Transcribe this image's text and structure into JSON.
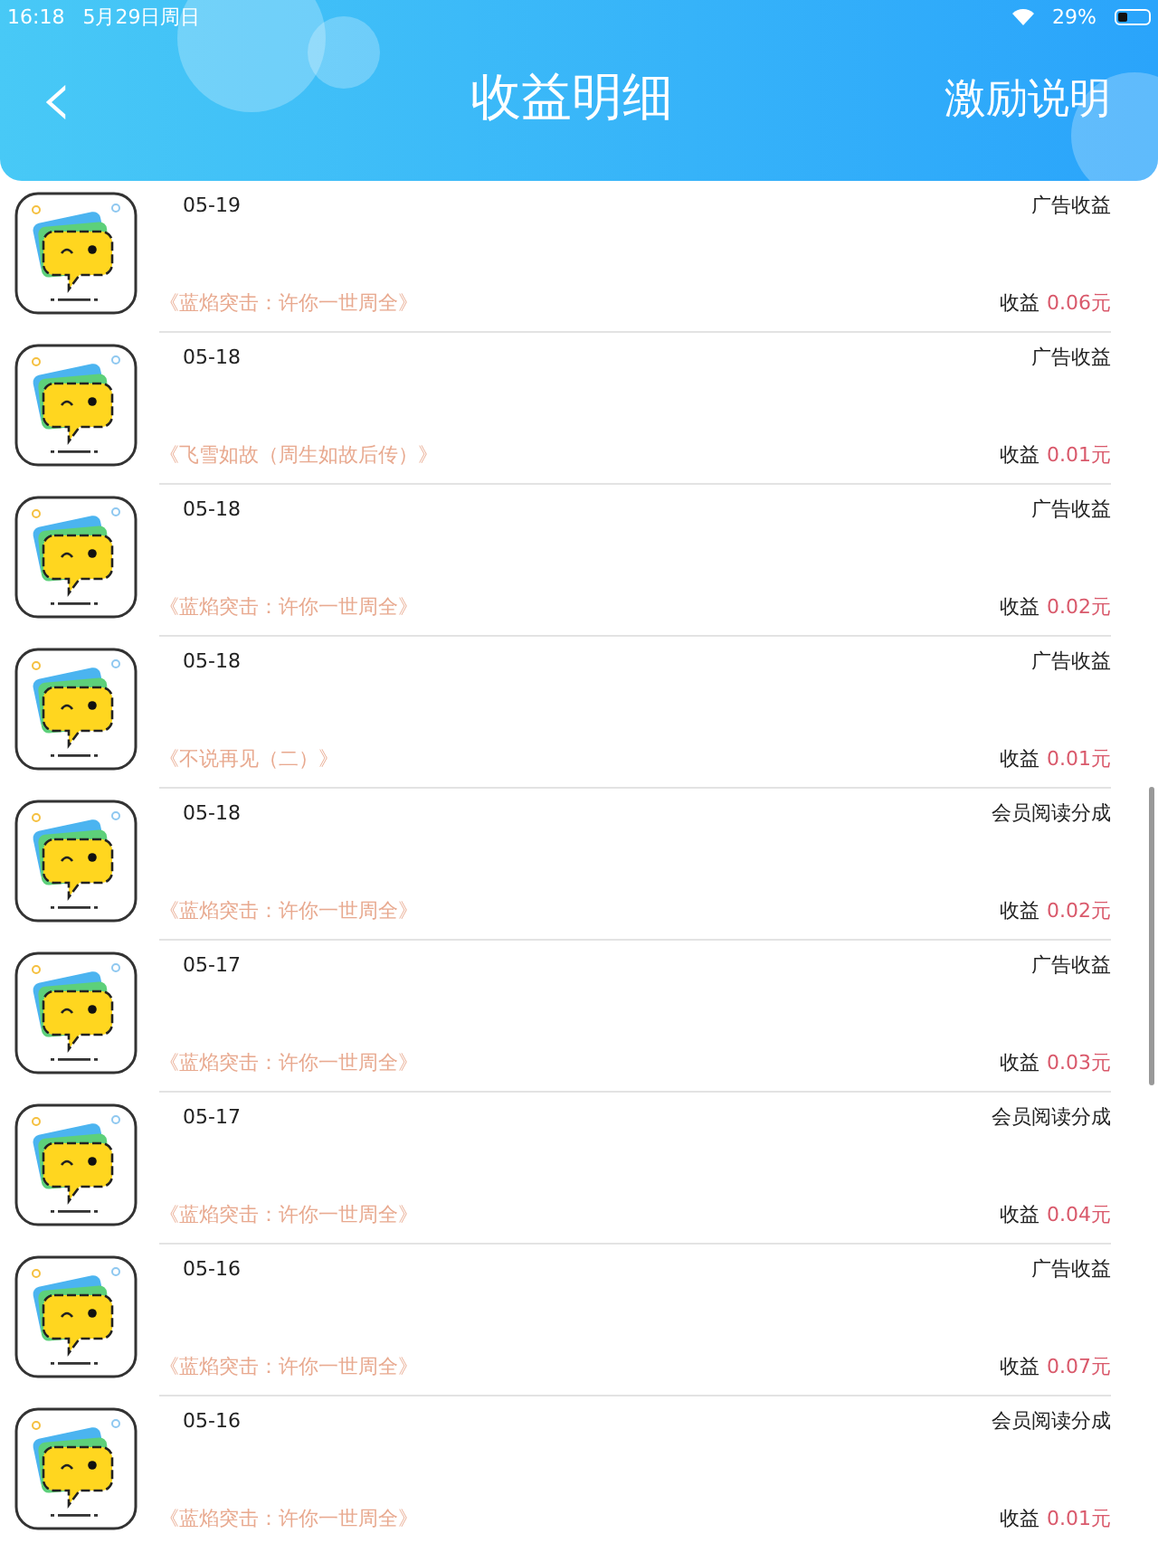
{
  "status_bar": {
    "time": "16:18",
    "date": "5月29日周日",
    "battery": "29%"
  },
  "header": {
    "back": "‹",
    "title": "收益明细",
    "action": "激励说明"
  },
  "rows": [
    {
      "date": "05-19",
      "type": "广告收益",
      "book": "《蓝焰突击：许你一世周全》",
      "earning_label": "收益",
      "amount": "0.06元"
    },
    {
      "date": "05-18",
      "type": "广告收益",
      "book": "《飞雪如故（周生如故后传）》",
      "earning_label": "收益",
      "amount": "0.01元"
    },
    {
      "date": "05-18",
      "type": "广告收益",
      "book": "《蓝焰突击：许你一世周全》",
      "earning_label": "收益",
      "amount": "0.02元"
    },
    {
      "date": "05-18",
      "type": "广告收益",
      "book": "《不说再见（二）》",
      "earning_label": "收益",
      "amount": "0.01元"
    },
    {
      "date": "05-18",
      "type": "会员阅读分成",
      "book": "《蓝焰突击：许你一世周全》",
      "earning_label": "收益",
      "amount": "0.02元"
    },
    {
      "date": "05-17",
      "type": "广告收益",
      "book": "《蓝焰突击：许你一世周全》",
      "earning_label": "收益",
      "amount": "0.03元"
    },
    {
      "date": "05-17",
      "type": "会员阅读分成",
      "book": "《蓝焰突击：许你一世周全》",
      "earning_label": "收益",
      "amount": "0.04元"
    },
    {
      "date": "05-16",
      "type": "广告收益",
      "book": "《蓝焰突击：许你一世周全》",
      "earning_label": "收益",
      "amount": "0.07元"
    },
    {
      "date": "05-16",
      "type": "会员阅读分成",
      "book": "《蓝焰突击：许你一世周全》",
      "earning_label": "收益",
      "amount": "0.01元"
    }
  ]
}
